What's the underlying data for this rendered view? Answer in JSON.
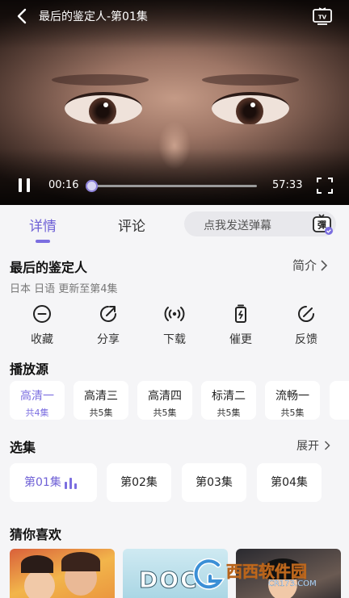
{
  "player": {
    "title": "最后的鉴定人-第01集",
    "current_time": "00:16",
    "total_time": "57:33",
    "progress_fraction": 0.005,
    "icons": [
      "back-arrow-icon",
      "tv-cast-icon",
      "pause-icon",
      "fullscreen-icon"
    ]
  },
  "tabs": {
    "details": "详情",
    "comments": "评论",
    "danmaku_placeholder": "点我发送弹幕",
    "danmaku_icon_text": "彈"
  },
  "show": {
    "title": "最后的鉴定人",
    "intro_label": "简介",
    "meta": "日本 日语 更新至第4集"
  },
  "actions": [
    {
      "label": "收藏",
      "icon": "favorite-icon"
    },
    {
      "label": "分享",
      "icon": "share-icon"
    },
    {
      "label": "下载",
      "icon": "download-icon"
    },
    {
      "label": "催更",
      "icon": "urge-update-icon"
    },
    {
      "label": "反馈",
      "icon": "feedback-icon"
    }
  ],
  "sources": {
    "title": "播放源",
    "items": [
      {
        "name": "高清一",
        "episodes": "共4集",
        "active": true
      },
      {
        "name": "高清三",
        "episodes": "共5集",
        "active": false
      },
      {
        "name": "高清四",
        "episodes": "共5集",
        "active": false
      },
      {
        "name": "标清二",
        "episodes": "共5集",
        "active": false
      },
      {
        "name": "流畅一",
        "episodes": "共5集",
        "active": false
      }
    ]
  },
  "episodes": {
    "title": "选集",
    "expand_label": "展开",
    "items": [
      {
        "label": "第01集",
        "active": true
      },
      {
        "label": "第02集",
        "active": false
      },
      {
        "label": "第03集",
        "active": false
      },
      {
        "label": "第04集",
        "active": false
      }
    ]
  },
  "recommend": {
    "title": "猜你喜欢",
    "thumb_texts": [
      "DOC"
    ]
  },
  "watermark": {
    "name": "西西软件园",
    "url": "CR173.COM"
  },
  "colors": {
    "accent": "#7b6ee0",
    "background": "#f5f5f7",
    "card": "#ffffff"
  }
}
